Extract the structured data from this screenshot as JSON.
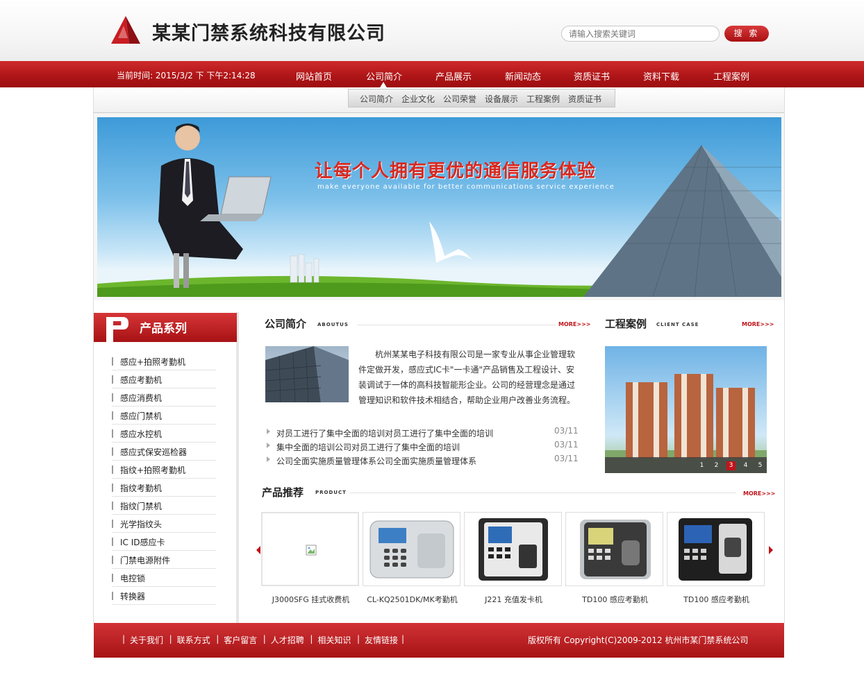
{
  "header": {
    "company_name": "某某门禁系统科技有限公司",
    "search_placeholder": "请输入搜索关键词",
    "search_button": "搜 索"
  },
  "nav": {
    "current_time": "当前时间: 2015/3/2 下 下午2:14:28",
    "items": [
      "网站首页",
      "公司简介",
      "产品展示",
      "新闻动态",
      "资质证书",
      "资料下载",
      "工程案例"
    ],
    "active_index": 1
  },
  "subnav": {
    "items": [
      "公司简介",
      "企业文化",
      "公司荣誉",
      "设备展示",
      "工程案例",
      "资质证书"
    ]
  },
  "banner": {
    "slogan": "让每个人拥有更优的通信服务体验",
    "subslogan": "make everyone available for better communications service experience"
  },
  "sidebar": {
    "title": "产品系列",
    "items": [
      "感应+拍照考勤机",
      "感应考勤机",
      "感应消费机",
      "感应门禁机",
      "感应水控机",
      "感应式保安巡检器",
      "指纹+拍照考勤机",
      "指纹考勤机",
      "指纹门禁机",
      "光学指纹头",
      "IC ID感应卡",
      "门禁电源附件",
      "电控锁",
      "转换器"
    ]
  },
  "about": {
    "title": "公司简介",
    "title_en": "ABOUTUS",
    "more": "MORE>>>",
    "text": "杭州某某电子科技有限公司是一家专业从事企业管理软件定做开发，感应式IC卡\"一卡通\"产品销售及工程设计、安装调试于一体的高科技智能形企业。公司的经营理念是通过管理知识和软件技术相结合，帮助企业用户改善业务流程。"
  },
  "news": [
    {
      "title": "对员工进行了集中全面的培训对员工进行了集中全面的培训",
      "date": "03/11"
    },
    {
      "title": "集中全面的培训公司对员工进行了集中全面的培训",
      "date": "03/11"
    },
    {
      "title": "公司全面实施质量管理体系公司全面实施质量管理体系",
      "date": "03/11"
    }
  ],
  "cases": {
    "title": "工程案例",
    "title_en": "CLIENT CASE",
    "more": "MORE>>>",
    "pages": [
      "1",
      "2",
      "3",
      "4",
      "5"
    ],
    "active_page": 2
  },
  "products": {
    "title": "产品推荐",
    "title_en": "PRODUCT",
    "more": "MORE>>>",
    "items": [
      {
        "name": "J3000SFG 挂式收费机"
      },
      {
        "name": "CL-KQ2501DK/MK考勤机"
      },
      {
        "name": "J221 充值发卡机"
      },
      {
        "name": "TD100 感应考勤机"
      },
      {
        "name": "TD100 感应考勤机"
      }
    ]
  },
  "footer": {
    "links": [
      "关于我们",
      "联系方式",
      "客户留言",
      "人才招聘",
      "相关知识",
      "友情链接"
    ],
    "copyright": "版权所有 Copyright(C)2009-2012 杭州市某门禁系统公司"
  },
  "colors": {
    "brand_red": "#b01618",
    "text": "#333333"
  }
}
